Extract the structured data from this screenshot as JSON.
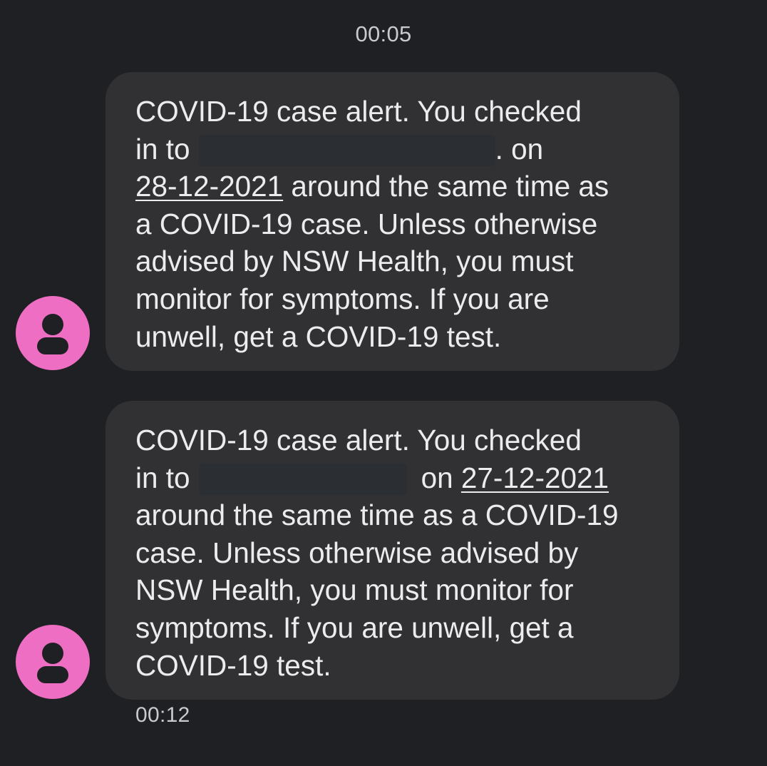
{
  "conversation": {
    "timestamps": {
      "first": "00:05",
      "last": "00:12"
    },
    "avatar_color": "#ee6ec3",
    "avatar_icon": "person-icon",
    "messages": [
      {
        "line1": "COVID-19 case alert. You checked",
        "in_to": "in to",
        "after_redaction": ". on",
        "date": "28-12-2021",
        "line3_rest": " around the same time as",
        "line4": "a COVID-19 case. Unless otherwise",
        "line5": "advised by NSW Health, you must",
        "line6": "monitor for symptoms. If you are",
        "line7": "unwell, get a COVID-19 test."
      },
      {
        "line1": "COVID-19 case alert. You checked",
        "in_to": "in to",
        "on": "on ",
        "date": "27-12-2021",
        "line3": "around the same time as a COVID-19",
        "line4": "case. Unless otherwise advised by",
        "line5": "NSW Health, you must monitor for",
        "line6": "symptoms. If you are unwell, get a",
        "line7": "COVID-19 test."
      }
    ]
  }
}
